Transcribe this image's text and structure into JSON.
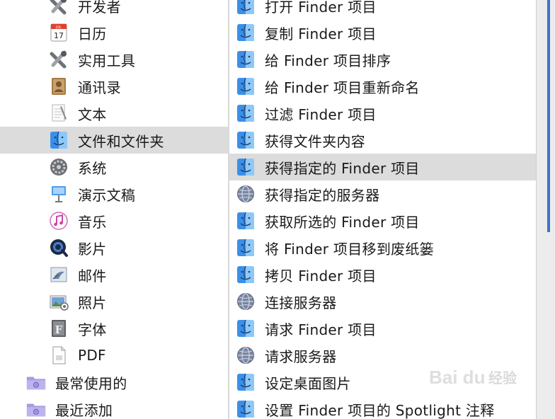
{
  "library": {
    "items": [
      {
        "label": "开发者",
        "icon": "developer-icon"
      },
      {
        "label": "日历",
        "icon": "calendar-icon",
        "calendar_month": "JUL",
        "calendar_day": "17"
      },
      {
        "label": "实用工具",
        "icon": "utilities-icon"
      },
      {
        "label": "通讯录",
        "icon": "contacts-icon"
      },
      {
        "label": "文本",
        "icon": "text-icon"
      },
      {
        "label": "文件和文件夹",
        "icon": "finder-icon",
        "selected": true
      },
      {
        "label": "系统",
        "icon": "system-icon"
      },
      {
        "label": "演示文稿",
        "icon": "presentation-icon"
      },
      {
        "label": "音乐",
        "icon": "music-icon"
      },
      {
        "label": "影片",
        "icon": "quicktime-icon"
      },
      {
        "label": "邮件",
        "icon": "mail-icon"
      },
      {
        "label": "照片",
        "icon": "photos-icon"
      },
      {
        "label": "字体",
        "icon": "font-icon"
      },
      {
        "label": "PDF",
        "icon": "pdf-icon"
      }
    ],
    "folders": [
      {
        "label": "最常使用的",
        "icon": "smart-folder-icon"
      },
      {
        "label": "最近添加",
        "icon": "smart-folder-icon"
      }
    ]
  },
  "actions": {
    "items": [
      {
        "label": "打开 Finder 项目",
        "icon": "finder-icon"
      },
      {
        "label": "复制 Finder 项目",
        "icon": "finder-icon"
      },
      {
        "label": "给 Finder 项目排序",
        "icon": "finder-icon"
      },
      {
        "label": "给 Finder 项目重新命名",
        "icon": "finder-icon"
      },
      {
        "label": "过滤 Finder 项目",
        "icon": "finder-icon"
      },
      {
        "label": "获得文件夹内容",
        "icon": "finder-icon"
      },
      {
        "label": "获得指定的 Finder 项目",
        "icon": "finder-icon",
        "selected": true
      },
      {
        "label": "获得指定的服务器",
        "icon": "network-globe-icon"
      },
      {
        "label": "获取所选的 Finder 项目",
        "icon": "finder-icon"
      },
      {
        "label": "将 Finder 项目移到废纸篓",
        "icon": "finder-icon"
      },
      {
        "label": "拷贝 Finder 项目",
        "icon": "finder-icon"
      },
      {
        "label": "连接服务器",
        "icon": "network-globe-icon"
      },
      {
        "label": "请求 Finder 项目",
        "icon": "finder-icon"
      },
      {
        "label": "请求服务器",
        "icon": "network-globe-icon"
      },
      {
        "label": "设定桌面图片",
        "icon": "finder-icon"
      },
      {
        "label": "设置 Finder 项目的 Spotlight 注释",
        "icon": "finder-icon"
      }
    ]
  },
  "watermark": {
    "text": "经验",
    "brand": "Bai du"
  },
  "colors": {
    "selection": "#dcdcdc",
    "finder_blue": "#3b8fe8",
    "accent_border": "#3f73c8"
  }
}
